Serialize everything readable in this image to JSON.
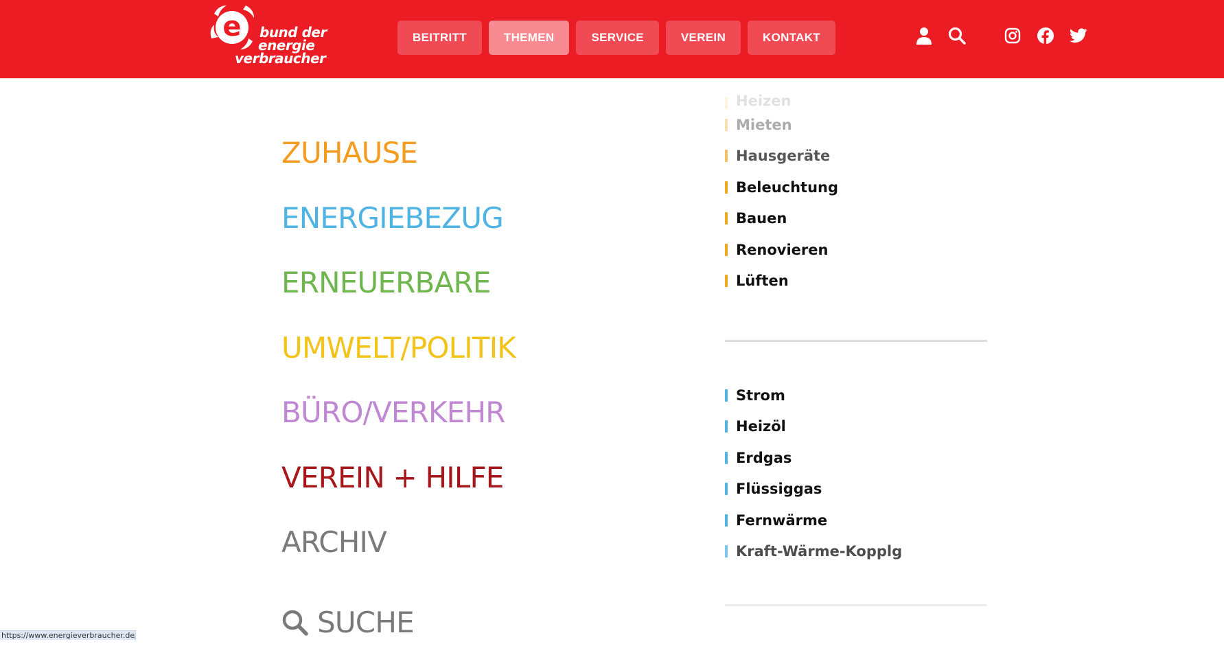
{
  "header": {
    "bg_color": "#eb1c24",
    "logo": {
      "letter": "e",
      "line1": "bund der",
      "line2": "energie",
      "line3": "verbraucher"
    },
    "nav": [
      {
        "label": "BEITRITT",
        "active": false
      },
      {
        "label": "THEMEN",
        "active": true
      },
      {
        "label": "SERVICE",
        "active": false
      },
      {
        "label": "VEREIN",
        "active": false
      },
      {
        "label": "KONTAKT",
        "active": false
      }
    ],
    "icons": [
      "user-icon",
      "search-icon",
      "instagram-icon",
      "facebook-icon",
      "twitter-icon"
    ]
  },
  "categories": [
    {
      "label": "ZUHAUSE",
      "color": "#f39c1f"
    },
    {
      "label": "ENERGIEBEZUG",
      "color": "#4fb3e3"
    },
    {
      "label": "ERNEUERBARE",
      "color": "#6fb64f"
    },
    {
      "label": "UMWELT/POLITIK",
      "color": "#f2c318"
    },
    {
      "label": "BÜRO/VERKEHR",
      "color": "#c087d3"
    },
    {
      "label": "VEREIN + HILFE",
      "color": "#a5171b"
    },
    {
      "label": "ARCHIV",
      "color": "#7a7a7a"
    },
    {
      "label": "SUCHE",
      "color": "#7a7a7a",
      "icon": "search-icon"
    }
  ],
  "submenu_zuhause": {
    "bar_color": "#f0a81e",
    "items": [
      {
        "label": "Heizen",
        "faded": "strong"
      },
      {
        "label": "Mieten",
        "faded": "light"
      },
      {
        "label": "Hausgeräte",
        "faded": "slight"
      },
      {
        "label": "Beleuchtung",
        "faded": "none"
      },
      {
        "label": "Bauen",
        "faded": "none"
      },
      {
        "label": "Renovieren",
        "faded": "none"
      },
      {
        "label": "Lüften",
        "faded": "none"
      }
    ]
  },
  "submenu_energiebezug": {
    "bar_color": "#4fb3e3",
    "items": [
      {
        "label": "Strom",
        "faded": "none"
      },
      {
        "label": "Heizöl",
        "faded": "none"
      },
      {
        "label": "Erdgas",
        "faded": "none"
      },
      {
        "label": "Flüssiggas",
        "faded": "none"
      },
      {
        "label": "Fernwärme",
        "faded": "none"
      },
      {
        "label": "Kraft-Wärme-Kopplg",
        "faded": "slight"
      }
    ]
  },
  "status_bar": {
    "url": "https://www.energieverbraucher.de/#"
  }
}
